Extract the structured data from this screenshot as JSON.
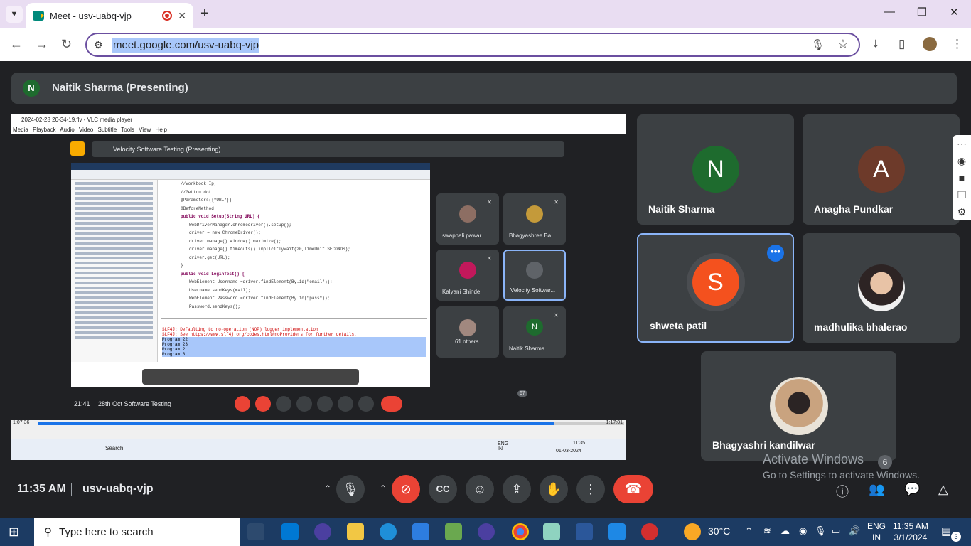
{
  "browser": {
    "tab_title": "Meet - usv-uabq-vjp",
    "url": "meet.google.com/usv-uabq-vjp"
  },
  "meet": {
    "presenter_initial": "N",
    "presenter_text": "Naitik Sharma (Presenting)",
    "clock": "11:35 AM",
    "meeting_code": "usv-uabq-vjp",
    "people_badge": "6"
  },
  "shared_screen": {
    "vlc_title": "2024-02-28 20-34-19.flv - VLC media player",
    "vlc_menu": "Media Playback Audio Video Subtitle Tools View Help",
    "inner_presenting": "Velocity Software Testing (Presenting)",
    "inner_time": "21:41",
    "inner_meeting": "28th Oct Software Testing",
    "inner_people_count": "67",
    "vlc_elapsed": "1:07:36",
    "vlc_total": "1:17:01",
    "vlc_progress": 0.88,
    "inner_search": "Search",
    "inner_lang": "ENG IN",
    "inner_clock": "11:35",
    "inner_date": "01-03-2024",
    "code_lines": [
      "//Workbook Ip;",
      "//Gettou.dot",
      "@Parameters({\"URL\"})",
      "@BeforeMethod",
      "public void Setup(String URL) {",
      "WebDriverManager.chromedriver().setup();",
      "driver = new ChromeDriver();",
      "driver.manage().window().maximize();",
      "driver.manage().timeouts().implicitlyWait(20,TimeUnit.SECONDS);",
      "driver.get(URL);",
      "}",
      "public void LoginTest() {",
      "WebElement Username =driver.findElement(By.id(\"email\"));",
      "Username.sendKeys(mail);",
      "WebElement Password =driver.findElement(By.id(\"pass\"));",
      "Password.sendKeys();"
    ],
    "console_lines": [
      "SLF4J: Defaulting to no-operation (NOP) logger implementation",
      "SLF4J: See https://www.slf4j.org/codes.html#noProviders for further details.",
      "Program 22",
      "Program 23",
      "Program 2",
      "Program 3"
    ],
    "tiles": [
      {
        "name": "swapnali pawar"
      },
      {
        "name": "Bhagyashree Ba..."
      },
      {
        "name": "Kalyani Shinde"
      },
      {
        "name": "Velocity Softwar..."
      },
      {
        "name": "61 others"
      },
      {
        "name": "Naitik Sharma",
        "initial": "N"
      }
    ]
  },
  "participants": [
    {
      "name": "Naitik Sharma",
      "initial": "N",
      "color": "#1e6b2e"
    },
    {
      "name": "Anagha Pundkar",
      "initial": "A",
      "color": "#6d3a2a"
    },
    {
      "name": "shweta patil",
      "initial": "S",
      "color": "#f4511e"
    },
    {
      "name": "madhulika bhalerao"
    },
    {
      "name": "Bhagyashri kandilwar"
    }
  ],
  "watermark": {
    "line1": "Activate Windows",
    "line2": "Go to Settings to activate Windows."
  },
  "taskbar": {
    "search_placeholder": "Type here to search",
    "temperature": "30°C",
    "lang1": "ENG",
    "lang2": "IN",
    "time": "11:35 AM",
    "date": "3/1/2024",
    "notifications": "3"
  },
  "colors": {
    "accent": "#1a73e8",
    "danger": "#ea4335",
    "surface": "#3c4043",
    "background": "#202124"
  }
}
